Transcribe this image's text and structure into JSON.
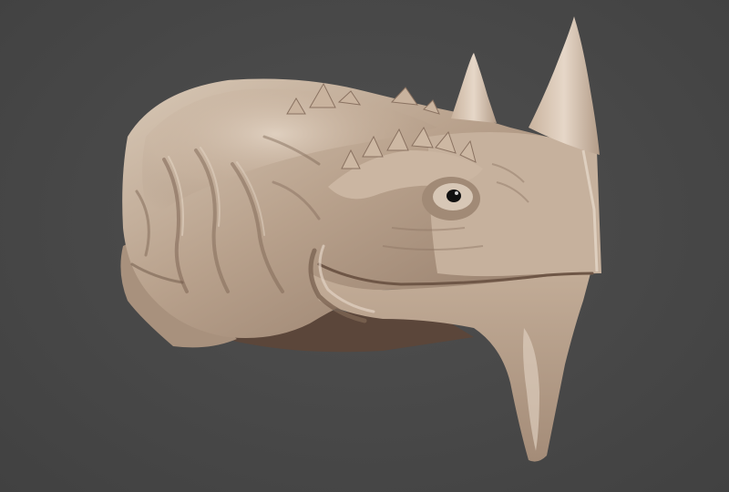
{
  "scene": {
    "background_color": "#4a4a4a",
    "subject": "creature-head-sculpt",
    "material_base_color": "#b49e8a",
    "material_highlight_color": "#e3d5c6",
    "material_shadow_color": "#6b5546",
    "eye_color": "#111111"
  }
}
